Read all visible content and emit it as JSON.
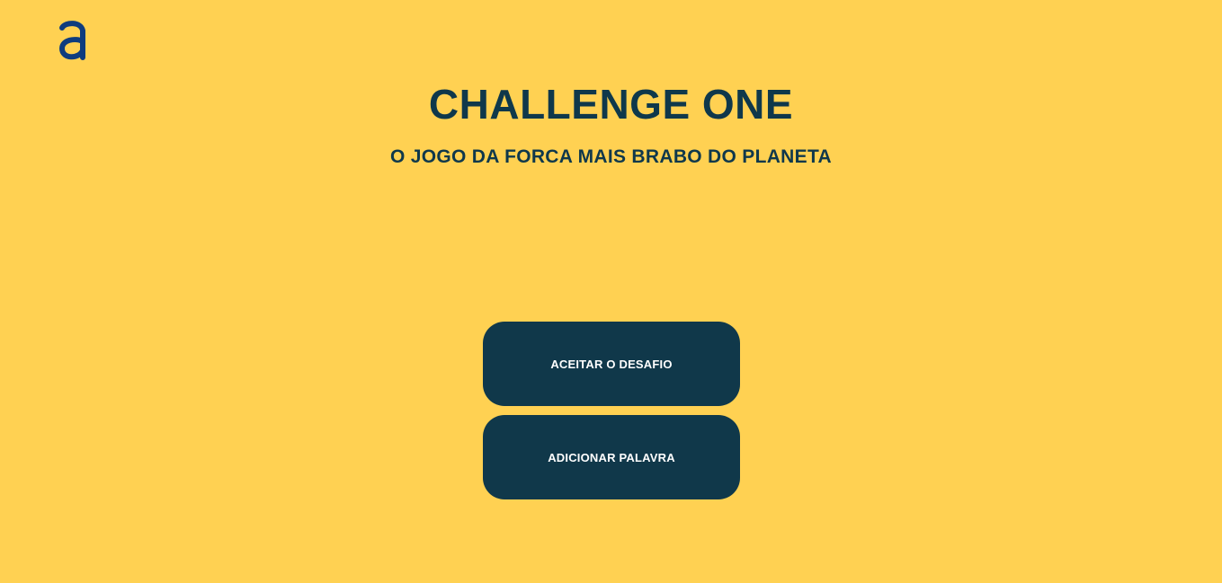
{
  "header": {
    "logo_icon": "alura-logo-icon",
    "logo_color": "#0F3C7E"
  },
  "main": {
    "title": "CHALLENGE ONE",
    "subtitle": "O JOGO DA FORCA MAIS BRABO DO PLANETA"
  },
  "actions": {
    "start_label": "ACEITAR O DESAFIO",
    "add_word_label": "ADICIONAR PALAVRA"
  },
  "colors": {
    "background": "#FFD152",
    "text": "#0F384B",
    "button": "#10384A",
    "button_text": "#FFFFFF"
  }
}
